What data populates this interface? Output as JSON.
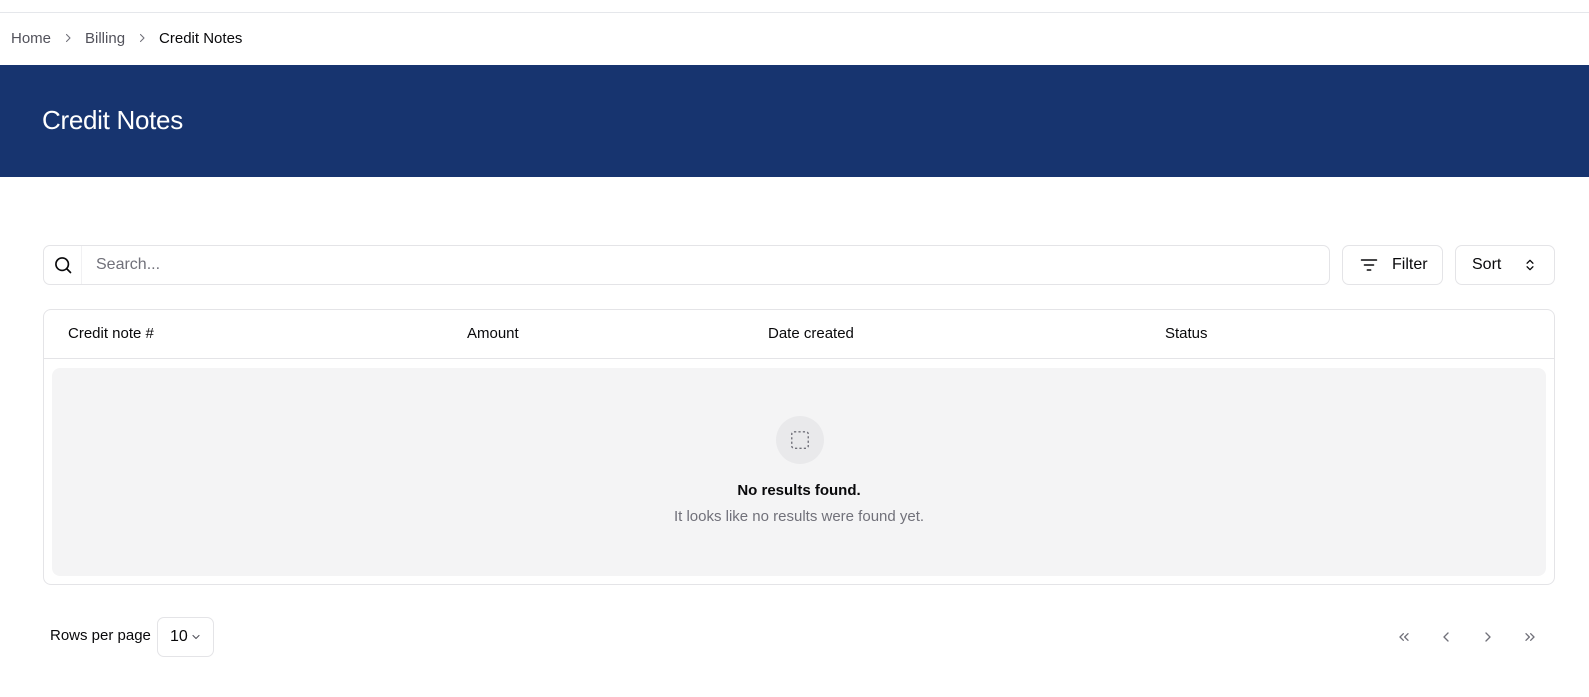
{
  "breadcrumb": {
    "items": [
      "Home",
      "Billing"
    ],
    "current": "Credit Notes"
  },
  "header": {
    "title": "Credit Notes",
    "background_color": "#17346f"
  },
  "toolbar": {
    "search_placeholder": "Search...",
    "search_value": "",
    "filter_label": "Filter",
    "sort_label": "Sort"
  },
  "table": {
    "columns": [
      "Credit note #",
      "Amount",
      "Date created",
      "Status"
    ],
    "rows": [],
    "empty_title": "No results found.",
    "empty_subtitle": "It looks like no results were found yet."
  },
  "pagination": {
    "rows_per_page_label": "Rows per page",
    "rows_per_page_value": "10"
  },
  "icons": {
    "search": "search-icon",
    "filter": "filter-icon",
    "sort": "chevrons-up-down-icon",
    "empty": "dashed-square-icon",
    "first": "chevrons-left-icon",
    "prev": "chevron-left-icon",
    "next": "chevron-right-icon",
    "last": "chevrons-right-icon"
  }
}
